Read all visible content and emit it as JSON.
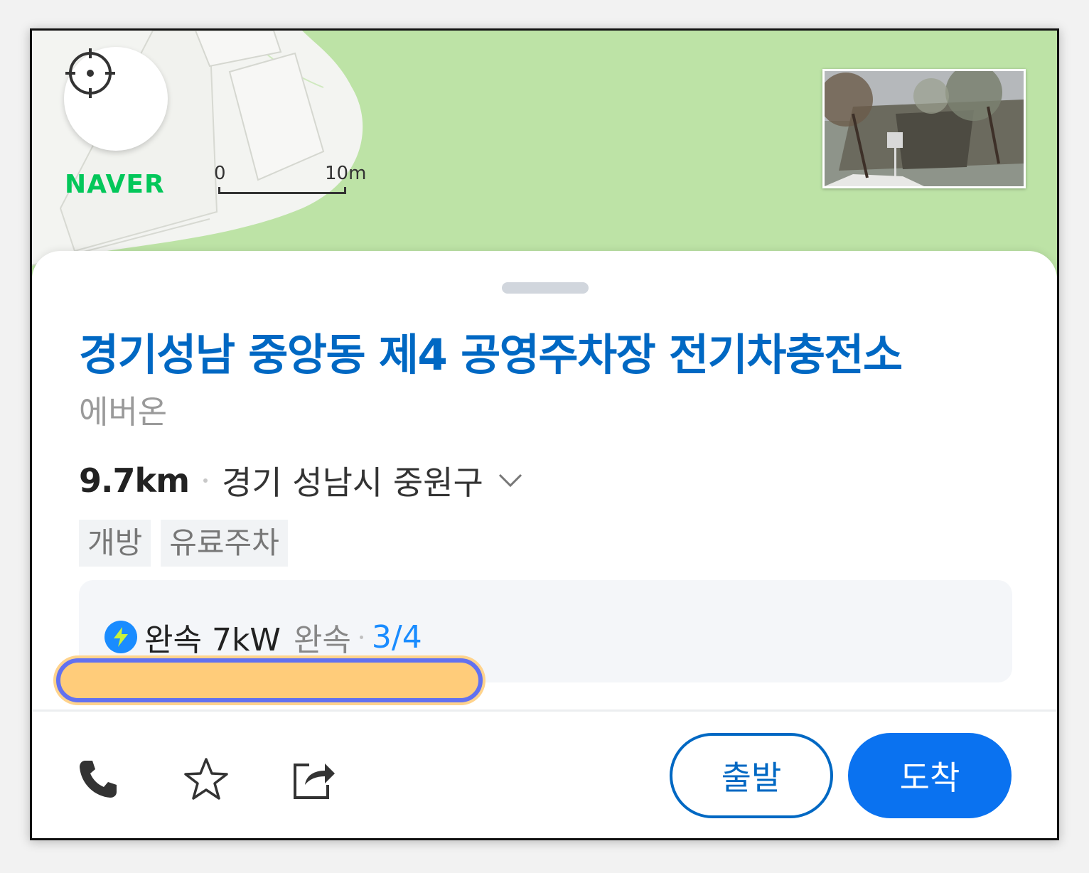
{
  "map": {
    "logo": "NAVER",
    "scale": {
      "start": "0",
      "end": "10m"
    },
    "colors": {
      "park": "#bde3a6",
      "naver_green": "#03c75a"
    }
  },
  "place": {
    "name": "경기성남 중앙동 제4 공영주차장 전기차충전소",
    "operator": "에버온",
    "distance": "9.7km",
    "address": "경기 성남시 중원구",
    "tags": [
      "개방",
      "유료주차"
    ]
  },
  "charger": {
    "type": "완속 7kW",
    "speed": "완속",
    "availability": "3/4"
  },
  "actions": {
    "depart_label": "출발",
    "arrive_label": "도착"
  },
  "colors": {
    "title": "#0068c3",
    "primary_button": "#0a72f0",
    "availability": "#1a8cff"
  }
}
